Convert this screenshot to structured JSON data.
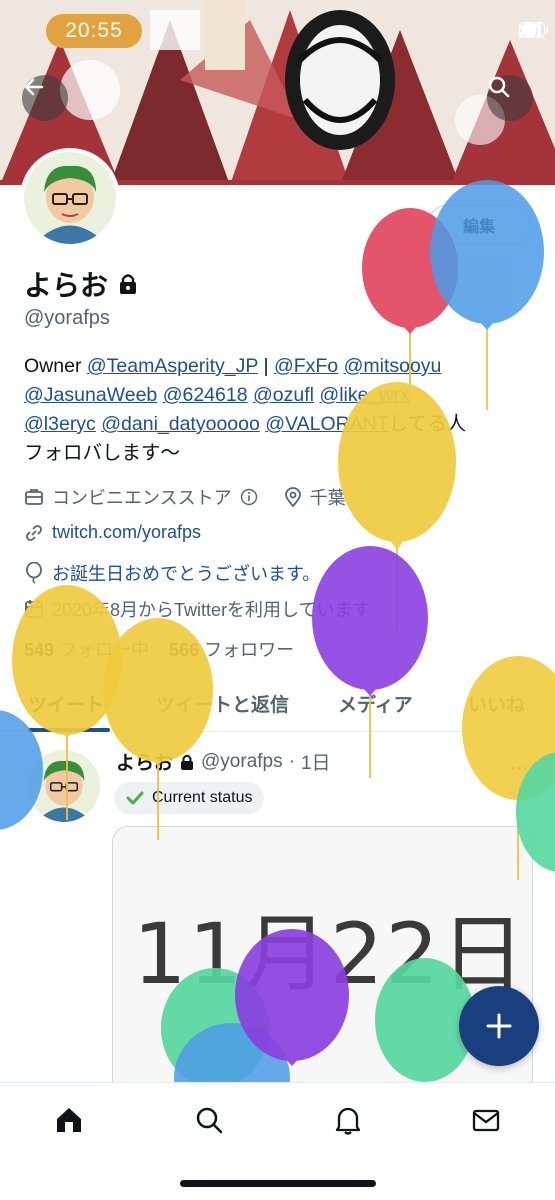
{
  "status_bar": {
    "time": "20:55"
  },
  "header": {
    "banner_alt": "profile banner",
    "back_icon": "back-arrow-icon",
    "search_icon": "search-icon"
  },
  "profile": {
    "display_name": "よらお",
    "handle": "@yorafps",
    "edit_label": "編集",
    "bio": {
      "prefix": "Owner ",
      "link1": "@TeamAsperity_JP",
      "sep1": " | ",
      "link2": "@FxFo",
      "sp1": " ",
      "link3": "@mitsooyu",
      "link4": "@JasunaWeeb",
      "link5": "@624618",
      "link6": "@ozufl",
      "link7": "@like_wrx",
      "link8": "@l3eryc",
      "link9": "@dani_datyooooo",
      "link10": "@VALORANT",
      "suffix": "してる人",
      "line2": "フォロバします〜"
    },
    "category": "コンビニエンスストア",
    "location": "千葉",
    "website": "twitch.com/yorafps",
    "birthday": "お誕生日おめでとうございます。",
    "joined": "2020年8月からTwitterを利用しています",
    "following_count": "549",
    "following_label": "フォロー中",
    "followers_count": "566",
    "followers_label": "フォロワー"
  },
  "tabs": [
    {
      "label": "ツイート",
      "active": true
    },
    {
      "label": "ツイートと返信",
      "active": false
    },
    {
      "label": "メディア",
      "active": false
    },
    {
      "label": "いいね",
      "active": false
    }
  ],
  "tweet": {
    "name": "よらお",
    "handle": "@yorafps",
    "dot": "·",
    "time": "1日",
    "more": "…",
    "badge": "Current status",
    "media_text": "11月22日"
  },
  "colors": {
    "accent": "#1d4f91",
    "fab": "#1a3f7e",
    "time_pill": "#e0a340"
  },
  "nav": [
    "home-icon",
    "search-icon",
    "notifications-bell-icon",
    "messages-mail-icon"
  ]
}
